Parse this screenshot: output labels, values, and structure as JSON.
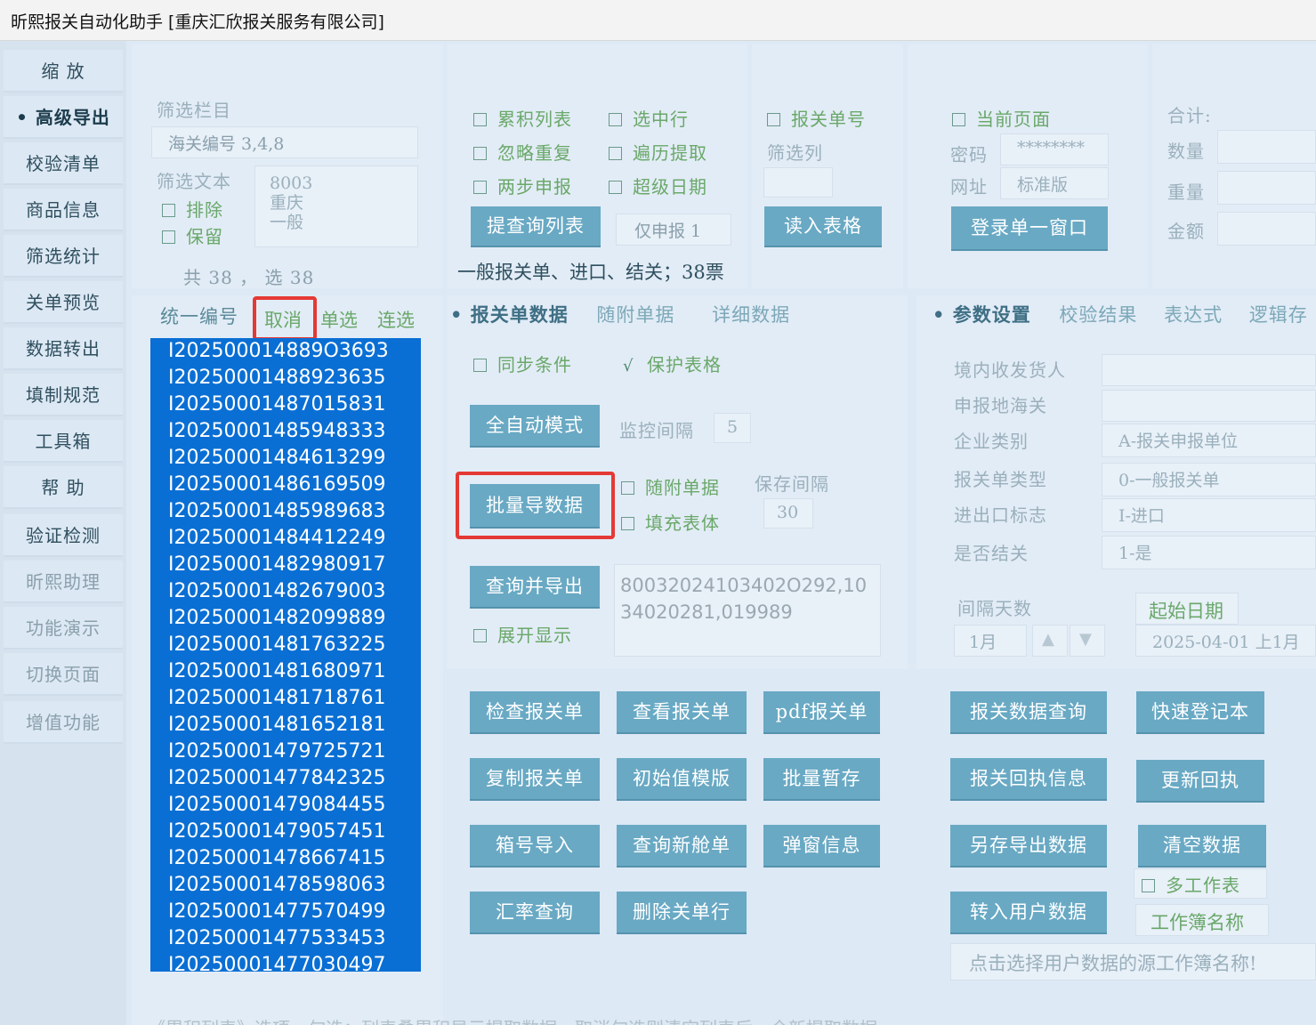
{
  "window": {
    "title": "昕熙报关自动化助手 [重庆汇欣报关服务有限公司]"
  },
  "sidebar": {
    "items": [
      {
        "label": "缩 放"
      },
      {
        "label": "高级导出"
      },
      {
        "label": "校验清单"
      },
      {
        "label": "商品信息"
      },
      {
        "label": "筛选统计"
      },
      {
        "label": "关单预览"
      },
      {
        "label": "数据转出"
      },
      {
        "label": "填制规范"
      },
      {
        "label": "工具箱"
      },
      {
        "label": "帮 助"
      },
      {
        "label": "验证检测"
      },
      {
        "label": "昕熙助理"
      },
      {
        "label": "功能演示"
      },
      {
        "label": "切换页面"
      },
      {
        "label": "增值功能"
      }
    ]
  },
  "filter": {
    "column_label": "筛选栏目",
    "column_value": "海关编号 3,4,8",
    "text_label": "筛选文本",
    "exclude": "排除",
    "keep": "保留",
    "text_values": [
      "8003",
      "重庆",
      "一般"
    ],
    "count": "共 38 ， 选 38"
  },
  "options": {
    "cumulative": "累积列表",
    "ignore_dup": "忽略重复",
    "two_step": "两步申报",
    "select_row": "选中行",
    "traverse": "遍历提取",
    "over_date": "超级日期",
    "extract_btn": "提查询列表",
    "only_declare": "仅申报 1",
    "summary": "一般报关单、进口、结关；38票"
  },
  "readsheet": {
    "decl_no": "报关单号",
    "filter_col": "筛选列",
    "read_btn": "读入表格"
  },
  "login": {
    "current_page": "当前页面",
    "pwd_label": "密码",
    "pwd_value": "********",
    "url_label": "网址",
    "url_value": "标准版",
    "login_btn": "登录单一窗口"
  },
  "totals": {
    "total": "合计:",
    "qty": "数量",
    "weight": "重量",
    "amount": "金额"
  },
  "list_header": {
    "unified_no": "统一编号",
    "cancel": "取消",
    "single": "单选",
    "multi": "连选"
  },
  "decl_list": [
    "I202500014889O3693",
    "I20250001488923635",
    "I20250001487015831",
    "I20250001485948333",
    "I20250001484613299",
    "I20250001486169509",
    "I20250001485989683",
    "I20250001484412249",
    "I20250001482980917",
    "I20250001482679003",
    "I20250001482099889",
    "I20250001481763225",
    "I20250001481680971",
    "I20250001481718761",
    "I20250001481652181",
    "I20250001479725721",
    "I20250001477842325",
    "I20250001479084455",
    "I20250001479057451",
    "I20250001478667415",
    "I20250001478598063",
    "I20250001477570499",
    "I20250001477533453",
    "I20250001477030497"
  ],
  "mid_tabs": {
    "decl_data": "报关单数据",
    "attached": "随附单据",
    "detail": "详细数据"
  },
  "mid": {
    "sync": "同步条件",
    "protect": "保护表格",
    "auto_btn": "全自动模式",
    "monitor_label": "监控间隔",
    "monitor_value": "5",
    "batch_btn": "批量导数据",
    "attach_chk": "随附单据",
    "fill_chk": "填充表体",
    "save_label": "保存间隔",
    "save_value": "30",
    "query_export_btn": "查询并导出",
    "expand": "展开显示",
    "query_text": "80032024103402O292,1034020281,019989",
    "buttons": [
      "检查报关单",
      "查看报关单",
      "pdf报关单",
      "复制报关单",
      "初始值模版",
      "批量暂存",
      "箱号导入",
      "查询新舱单",
      "弹窗信息",
      "汇率查询",
      "删除关单行"
    ]
  },
  "right_tabs": {
    "params": "参数设置",
    "check_result": "校验结果",
    "expression": "表达式",
    "logic": "逻辑存"
  },
  "params": {
    "consignee_label": "境内收发货人",
    "customs_label": "申报地海关",
    "ent_type_label": "企业类别",
    "ent_type_value": "A-报关申报单位",
    "decl_type_label": "报关单类型",
    "decl_type_value": "0-一般报关单",
    "ie_flag_label": "进出口标志",
    "ie_flag_value": "I-进口",
    "closed_label": "是否结关",
    "closed_value": "1-是",
    "interval_label": "间隔天数",
    "interval_value": "1月",
    "start_label": "起始日期",
    "start_value": "2025-04-01 上1月"
  },
  "right_buttons": {
    "query": "报关数据查询",
    "quick": "快速登记本",
    "receipt": "报关回执信息",
    "update": "更新回执",
    "save_export": "另存导出数据",
    "clear": "清空数据",
    "multi_sheet": "多工作表",
    "user_data": "转入用户数据",
    "book_name": "工作簿名称",
    "hint": "点击选择用户数据的源工作簿名称!"
  },
  "footer": {
    "tip": "《累积列表》选项，勾选：列表叠累积显示提取数据，取消勾选则清空列表后，全新提取数据"
  }
}
